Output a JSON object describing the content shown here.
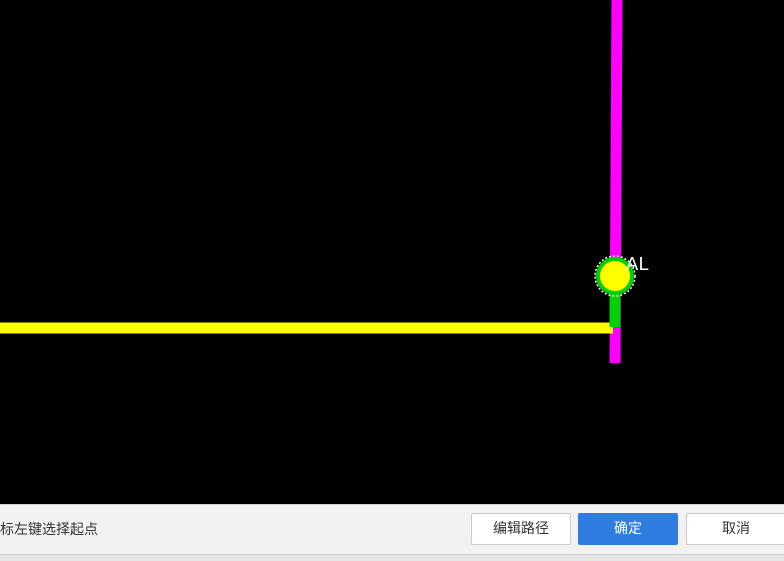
{
  "canvas": {
    "background": "#000000",
    "wires": [
      {
        "name": "magenta-wire",
        "color": "#ff00ff"
      },
      {
        "name": "yellow-wire",
        "color": "#ffff00"
      },
      {
        "name": "green-wire",
        "color": "#00d200"
      }
    ],
    "node": {
      "label": "AL",
      "fill_color": "#ffff00",
      "ring_color": "#00d200"
    }
  },
  "status_bar": {
    "hint": "标左键选择起点",
    "edit_path_label": "编辑路径",
    "ok_label": "确定",
    "cancel_label": "取消",
    "accent_color": "#2f7de1"
  }
}
